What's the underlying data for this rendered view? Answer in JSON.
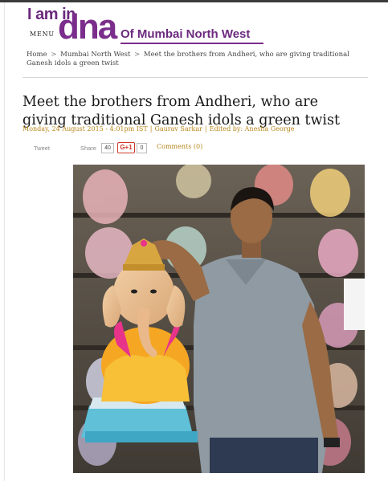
{
  "header": {
    "logo_prefix": "I am in",
    "logo_mark": "dna",
    "logo_suffix": "Of Mumbai North West",
    "menu_label": "MENU"
  },
  "breadcrumb": {
    "items": [
      "Home",
      "Mumbai North West"
    ],
    "current": "Meet the brothers from Andheri, who are giving traditional Ganesh idols a green twist",
    "separator": ">"
  },
  "article": {
    "title": "Meet the brothers from Andheri, who are giving traditional Ganesh idols a green twist",
    "date": "Monday, 24 August 2015 - 4:01pm IST",
    "author": "Gaurav Sarkar",
    "edited_by": "Edited by: Anesha George"
  },
  "share": {
    "tweet_label": "Tweet",
    "share_label": "Share",
    "facebook_count": "40",
    "gplus_label": "G+1",
    "gplus_count": "0",
    "comments_label": "Comments (0)"
  },
  "colors": {
    "brand": "#7b2d8c",
    "meta_accent": "#b8861b",
    "gplus": "#d13a2a"
  }
}
